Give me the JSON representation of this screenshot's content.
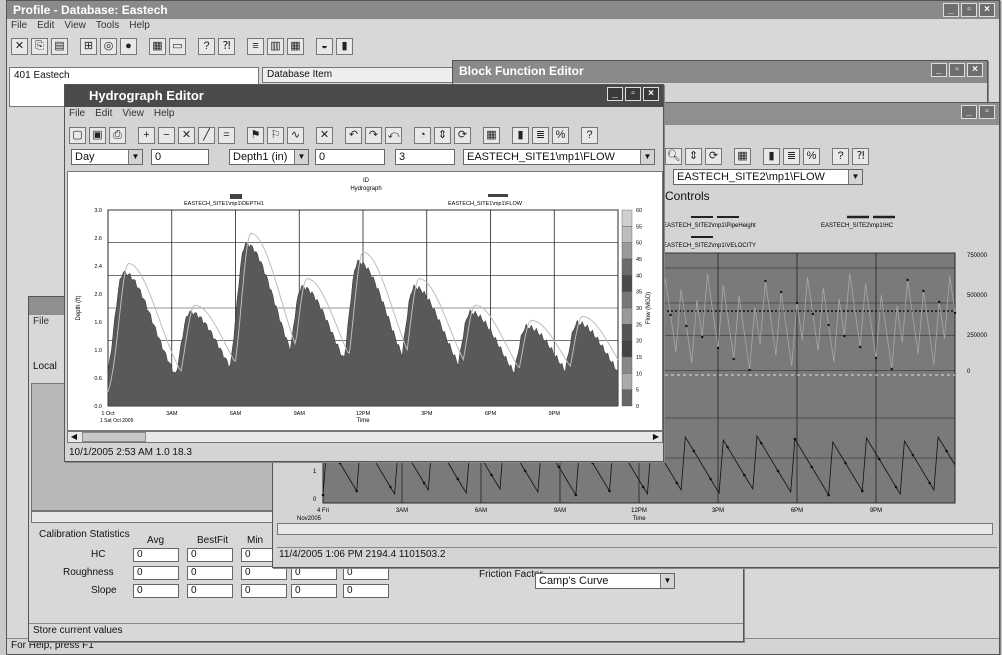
{
  "main": {
    "title": "Profile - Database: Eastech",
    "menu": [
      "File",
      "Edit",
      "View",
      "Tools",
      "Help"
    ],
    "tree_root": "401 Eastech",
    "db_item_header": "Database Item",
    "status": "For Help, press F1"
  },
  "block_function": {
    "title": "Block Function Editor"
  },
  "hydrograph": {
    "title": "Hydrograph Editor",
    "menu": [
      "File",
      "Edit",
      "View",
      "Help"
    ],
    "interval": "Day",
    "field1": "0",
    "depth_select": "Depth1 (in)",
    "field2": "0",
    "field3": "3",
    "flow_select": "EASTECH_SITE1\\mp1\\FLOW",
    "status": "10/1/2005 2:53 AM  1.0  18.3"
  },
  "hydro_chart": {
    "title_top": "ID",
    "title_sub": "Hydrograph",
    "legend_depth": "EASTECH_SITE1\\mp1\\DEPTH1",
    "legend_flow": "EASTECH_SITE1\\mp1\\FLOW",
    "ylabel_left": "Depth (ft)",
    "ylabel_right": "Flow (MGD)",
    "xlabel": "Time",
    "yticks_left": [
      "3.0",
      "2.6",
      "2.4",
      "2.0",
      "1.6",
      "1.0",
      "0.6",
      "0.0"
    ],
    "yticks_right": [
      "60",
      "55",
      "50",
      "45",
      "40",
      "35",
      "30",
      "25",
      "20",
      "15",
      "10",
      "5",
      "0"
    ],
    "xticks": [
      "1 Oct",
      "3AM",
      "6AM",
      "9AM",
      "12PM",
      "3PM",
      "6PM",
      "9PM"
    ],
    "xdate": "1 Sat Oct 2005"
  },
  "site2": {
    "flow_select": "EASTECH_SITE2\\mp1\\FLOW",
    "controls_label": "Controls",
    "legend1": "EASTECH_SITE2\\mp1\\PipeHeight",
    "legend2": "EASTECH_SITE2\\mp1\\HC",
    "legend3": "EASTECH_SITE2\\mp1\\VELOCITY",
    "yticks_right": [
      "750000",
      "500000",
      "250000",
      "0"
    ],
    "xticks": [
      "4 Fri",
      "3AM",
      "6AM",
      "9AM",
      "12PM",
      "3PM",
      "6PM",
      "9PM"
    ],
    "xdate": "Nov2005",
    "xlabel": "Time",
    "y2ticks": [
      "1",
      "0"
    ],
    "status": "11/4/2005 1:06 PM  2194.4  1101503.2"
  },
  "calibration": {
    "title": "Calibration Statistics",
    "cols": [
      "Avg",
      "BestFit",
      "Min"
    ],
    "rows": [
      {
        "label": "HC",
        "values": [
          "0",
          "0",
          "0"
        ]
      },
      {
        "label": "Roughness",
        "values": [
          "0",
          "0",
          "0",
          "0",
          "0"
        ]
      },
      {
        "label": "Slope",
        "values": [
          "0",
          "0",
          "0",
          "0",
          "0"
        ]
      }
    ],
    "friction_label": "Friction Factor",
    "friction_value": "Camp's Curve",
    "store_status": "Store current values"
  },
  "small_win": {
    "menu_file": "File",
    "local_label": "Local"
  },
  "colors": {
    "fill_dark": "#5c5c5c",
    "plot_bg": "#7c7c7c",
    "title_active": "#4a4a4a",
    "title_inactive": "#9c9c9c"
  }
}
